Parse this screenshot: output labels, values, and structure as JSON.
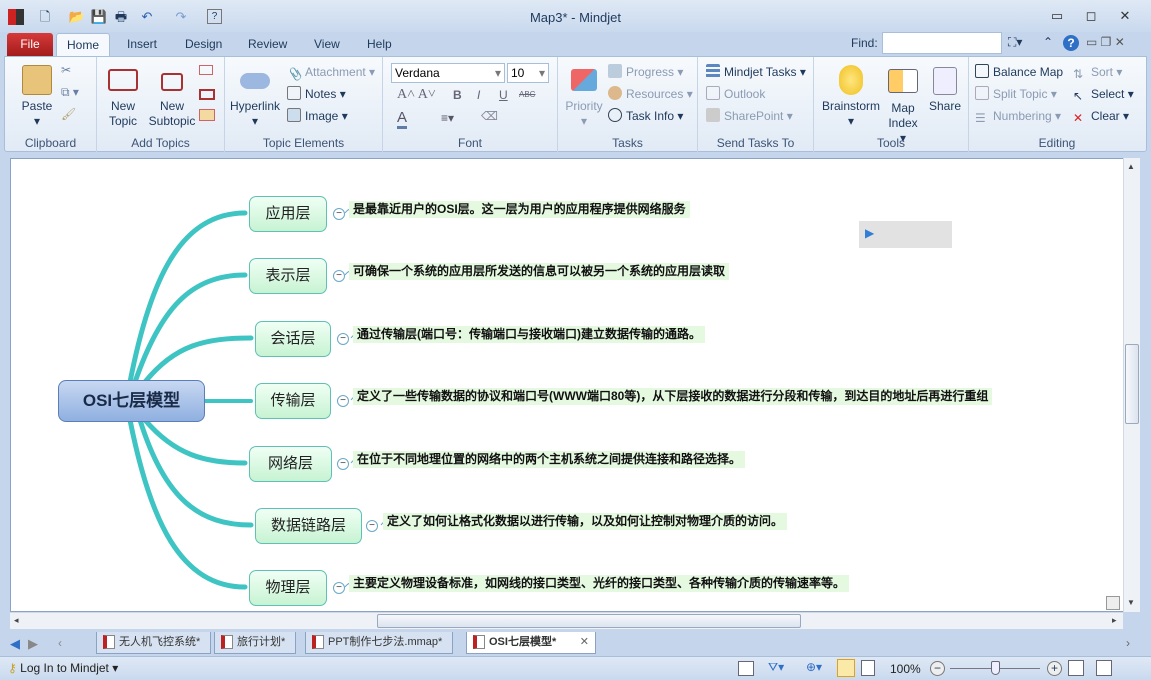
{
  "window": {
    "title": "Map3* - Mindjet",
    "find_label": "Find:",
    "find_value": ""
  },
  "menu_tabs": [
    "File",
    "Home",
    "Insert",
    "Design",
    "Review",
    "View",
    "Help"
  ],
  "ribbon": {
    "clipboard": {
      "label": "Clipboard",
      "paste": "Paste"
    },
    "add_topics": {
      "label": "Add Topics",
      "new_topic": "New Topic",
      "new_subtopic": "New Subtopic"
    },
    "topic_elements": {
      "label": "Topic Elements",
      "hyperlink": "Hyperlink",
      "attachment": "Attachment",
      "notes": "Notes",
      "image": "Image"
    },
    "font": {
      "label": "Font",
      "family": "Verdana",
      "size": "10",
      "bold": "B",
      "italic": "I",
      "underline": "U",
      "strike": "ABC"
    },
    "tasks": {
      "label": "Tasks",
      "priority": "Priority",
      "progress": "Progress",
      "resources": "Resources",
      "task_info": "Task Info"
    },
    "send_tasks": {
      "label": "Send Tasks To",
      "mindjet_tasks": "Mindjet Tasks",
      "outlook": "Outlook",
      "sharepoint": "SharePoint"
    },
    "tools": {
      "label": "Tools",
      "brainstorm": "Brainstorm",
      "map_index": "Map Index",
      "share": "Share"
    },
    "editing": {
      "label": "Editing",
      "balance_map": "Balance Map",
      "sort": "Sort",
      "split_topic": "Split Topic",
      "select": "Select",
      "numbering": "Numbering",
      "clear": "Clear"
    }
  },
  "map": {
    "central": "OSI七层模型",
    "nodes": [
      {
        "label": "应用层",
        "desc": "是最靠近用户的OSI层。这一层为用户的应用程序提供网络服务"
      },
      {
        "label": "表示层",
        "desc": "可确保一个系统的应用层所发送的信息可以被另一个系统的应用层读取"
      },
      {
        "label": "会话层",
        "desc": "通过传输层(端口号：传输端口与接收端口)建立数据传输的通路。"
      },
      {
        "label": "传输层",
        "desc": "定义了一些传输数据的协议和端口号(WWW端口80等)，从下层接收的数据进行分段和传输，到达目的地址后再进行重组"
      },
      {
        "label": "网络层",
        "desc": "在位于不同地理位置的网络中的两个主机系统之间提供连接和路径选择。"
      },
      {
        "label": "数据链路层",
        "desc": "定义了如何让格式化数据以进行传输，以及如何让控制对物理介质的访问。"
      },
      {
        "label": "物理层",
        "desc": "主要定义物理设备标准，如网线的接口类型、光纤的接口类型、各种传输介质的传输速率等。"
      }
    ],
    "collapse_symbol": "−"
  },
  "doc_tabs": [
    "无人机飞控系统*",
    "旅行计划*",
    "PPT制作七步法.mmap*",
    "OSI七层模型*"
  ],
  "status": {
    "login": "Log In to Mindjet",
    "zoom": "100%"
  },
  "colors": {
    "branch": "#3fc4c4",
    "file_tab": "#c0272d",
    "node_border": "#5fc0b6"
  }
}
